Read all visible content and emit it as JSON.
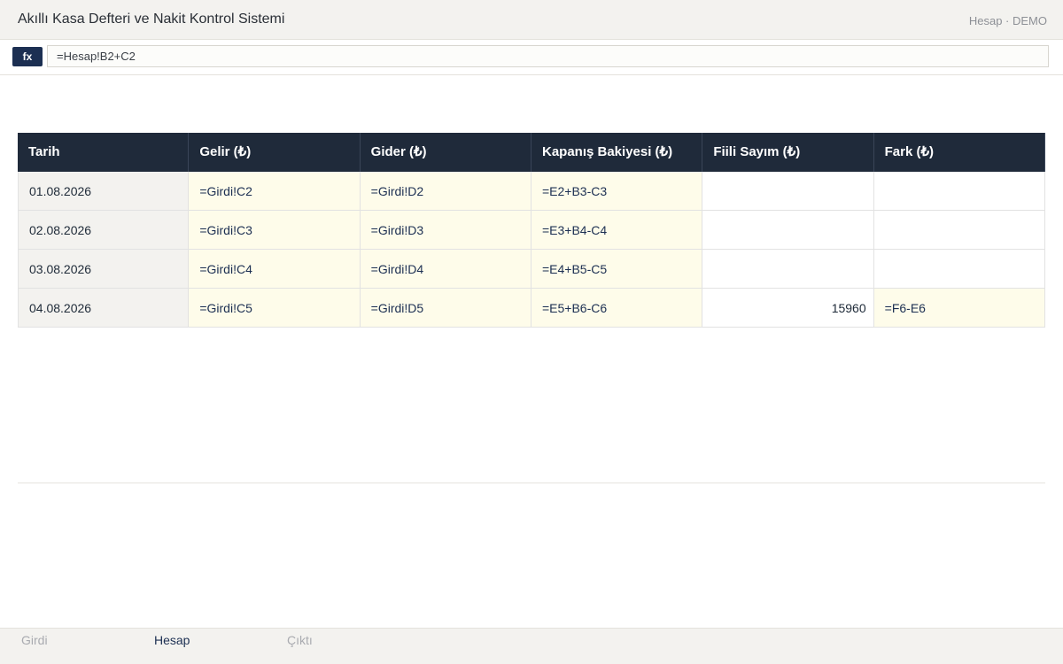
{
  "app": {
    "title": "Akıllı Kasa Defteri ve Nakit Kontrol Sistemi",
    "sheet_label": "Hesap · DEMO"
  },
  "formula_bar": {
    "fx_label": "fx",
    "value": "=Hesap!B2+C2"
  },
  "table": {
    "headers": [
      "Tarih",
      "Gelir (₺)",
      "Gider (₺)",
      "Kapanış Bakiyesi (₺)",
      "Fiili Sayım (₺)",
      "Fark (₺)"
    ],
    "rows": [
      [
        "01.08.2026",
        "=Girdi!C2",
        "=Girdi!D2",
        "=E2+B3-C3",
        "",
        ""
      ],
      [
        "02.08.2026",
        "=Girdi!C3",
        "=Girdi!D3",
        "=E3+B4-C4",
        "",
        ""
      ],
      [
        "03.08.2026",
        "=Girdi!C4",
        "=Girdi!D4",
        "=E4+B5-C5",
        "",
        ""
      ],
      [
        "04.08.2026",
        "=Girdi!C5",
        "=Girdi!D5",
        "=E5+B6-C6",
        "15960",
        "=F6-E6"
      ]
    ]
  },
  "tabs": [
    {
      "label": "Girdi",
      "active": false
    },
    {
      "label": "Hesap",
      "active": true
    },
    {
      "label": "Çıktı",
      "active": false
    }
  ],
  "colors": {
    "header_bg": "#1f2a3a",
    "accent": "#1c2f52",
    "formula_cell_bg": "#fefcea",
    "date_cell_bg": "#f3f2ef"
  }
}
